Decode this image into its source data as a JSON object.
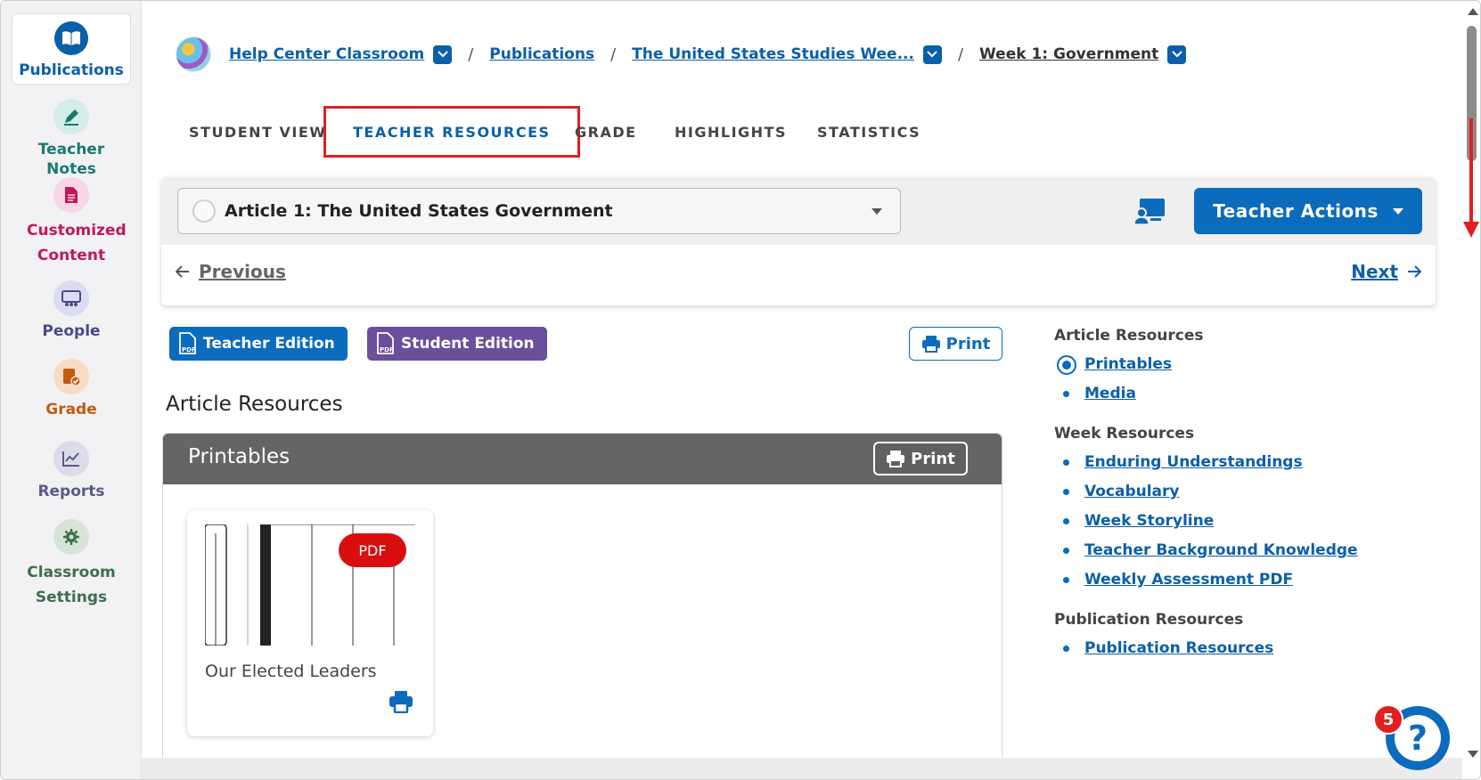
{
  "sidebar": {
    "items": [
      {
        "label": "Publications",
        "icon": "book-open-icon",
        "color": "#0b5fa8"
      },
      {
        "label": "Teacher Notes",
        "icon": "pen-icon",
        "color": "#1a7a6e"
      },
      {
        "label": "Customized Content",
        "icon": "document-icon",
        "color": "#c2185b"
      },
      {
        "label": "People",
        "icon": "people-icon",
        "color": "#4a4a8a"
      },
      {
        "label": "Grade",
        "icon": "grade-icon",
        "color": "#c45a10"
      },
      {
        "label": "Reports",
        "icon": "chart-icon",
        "color": "#5a5a8a"
      },
      {
        "label": "Classroom Settings",
        "icon": "gear-icon",
        "color": "#3e6e4e"
      }
    ]
  },
  "breadcrumb": {
    "items": [
      {
        "label": "Help Center Classroom",
        "has_dropdown": true
      },
      {
        "label": "Publications",
        "has_dropdown": false
      },
      {
        "label": "The United States Studies Wee...",
        "has_dropdown": true
      },
      {
        "label": "Week 1: Government",
        "has_dropdown": true
      }
    ],
    "separator": "/"
  },
  "tabs": [
    {
      "label": "STUDENT VIEW",
      "active": false
    },
    {
      "label": "TEACHER RESOURCES",
      "active": true
    },
    {
      "label": "GRADE",
      "active": false
    },
    {
      "label": "HIGHLIGHTS",
      "active": false
    },
    {
      "label": "STATISTICS",
      "active": false
    }
  ],
  "article": {
    "selected": "Article 1: The United States Government",
    "teacher_actions_label": "Teacher Actions",
    "previous_label": "Previous",
    "next_label": "Next"
  },
  "editions": {
    "teacher_label": "Teacher Edition",
    "student_label": "Student Edition",
    "print_label": "Print"
  },
  "main": {
    "section_title": "Article Resources",
    "panel_title": "Printables",
    "panel_print_label": "Print",
    "card": {
      "title": "Our Elected Leaders",
      "badge": "PDF"
    }
  },
  "right_nav": {
    "groups": [
      {
        "heading": "Article Resources",
        "links": [
          "Printables",
          "Media"
        ],
        "current": "Printables"
      },
      {
        "heading": "Week Resources",
        "links": [
          "Enduring Understandings",
          "Vocabulary",
          "Week Storyline",
          "Teacher Background Knowledge",
          "Weekly Assessment PDF"
        ]
      },
      {
        "heading": "Publication Resources",
        "links": [
          "Publication Resources"
        ]
      }
    ]
  },
  "help": {
    "badge_count": "5",
    "glyph": "?"
  },
  "colors": {
    "primary": "#0b6bbd",
    "student_purple": "#6a4f9c",
    "highlight_red": "#e02020",
    "pdf_red": "#d90f0f"
  }
}
